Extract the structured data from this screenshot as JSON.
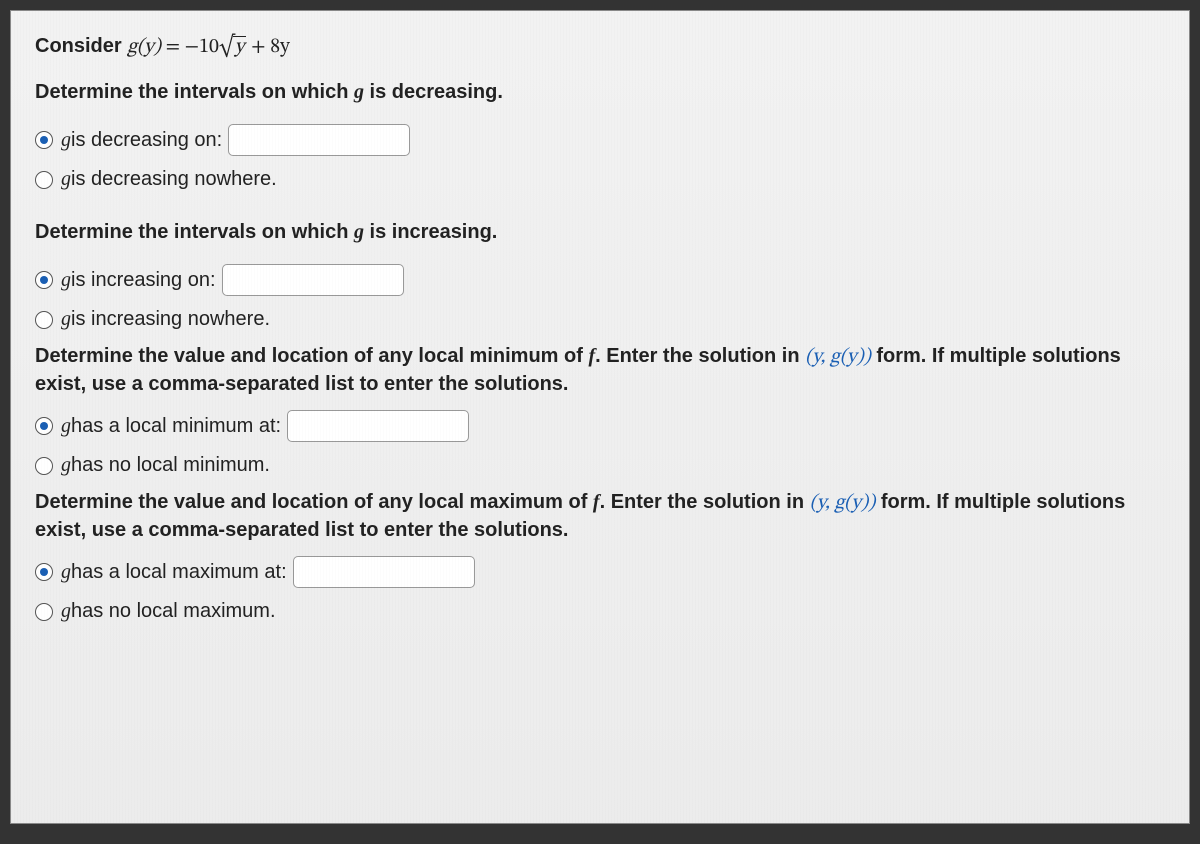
{
  "intro": {
    "prefix": "Consider ",
    "func_lhs": "g(y)",
    "equals": " = ",
    "rhs_neg": "−10",
    "rhs_radicand": "y",
    "rhs_tail": " + 8y"
  },
  "q1": {
    "prompt": "Determine the intervals on which g is decreasing.",
    "opt1_pre": " is decreasing on:",
    "opt2_pre": " is decreasing nowhere.",
    "g": "g"
  },
  "q2": {
    "prompt": "Determine the intervals on which g is increasing.",
    "opt1_pre": " is increasing on:",
    "opt2_pre": " is increasing nowhere.",
    "g": "g"
  },
  "q3": {
    "prompt_pre": "Determine the value and location of any local minimum of ",
    "f": "f",
    "prompt_mid": ". Enter the solution in ",
    "pair": "(y, g(y))",
    "prompt_tail": " form. If multiple solutions exist, use a comma-separated list to enter the solutions.",
    "opt1_pre": " has a local minimum at:",
    "opt2_pre": " has no local minimum.",
    "g": "g"
  },
  "q4": {
    "prompt_pre": "Determine the value and location of any local maximum of ",
    "f": "f",
    "prompt_mid": ". Enter the solution in ",
    "pair": "(y, g(y))",
    "prompt_tail": " form. If multiple solutions exist, use a comma-separated list to enter the solutions.",
    "opt1_pre": " has a local maximum at:",
    "opt2_pre": " has no local maximum.",
    "g": "g"
  }
}
